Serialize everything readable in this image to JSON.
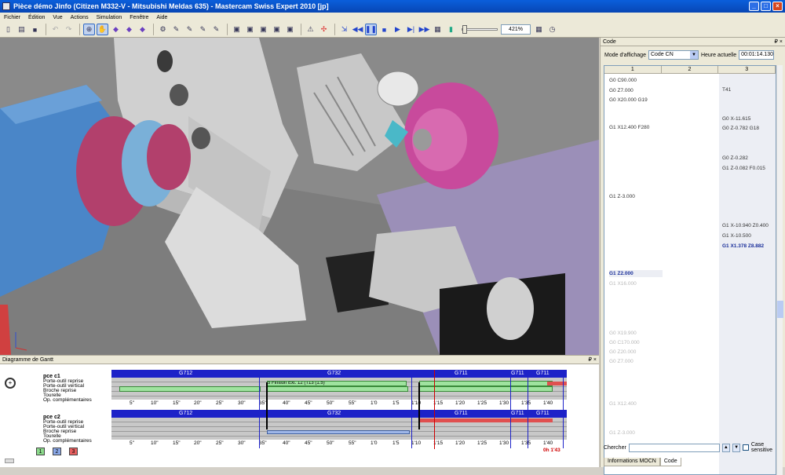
{
  "window": {
    "title": "Pièce démo Jinfo (Citizen M332-V - Mitsubishi Meldas 635) - Mastercam Swiss Expert 2010 [jp]"
  },
  "menu": [
    "Fichier",
    "Édition",
    "Vue",
    "Actions",
    "Simulation",
    "Fenêtre",
    "Aide"
  ],
  "toolbar": {
    "zoom": "421%"
  },
  "code_panel": {
    "title": "Code",
    "mode_label": "Mode d'affichage",
    "mode_value": "Code CN",
    "time_label": "Heure actuelle",
    "time_value": "00:01:14.130",
    "columns": [
      "1",
      "2",
      "3"
    ],
    "lines_col1": [
      {
        "text": "G0 C90.000",
        "state": "done"
      },
      {
        "text": "G0 Z7.000",
        "state": "done"
      },
      {
        "text": "G0 X20.000 G19",
        "state": "done"
      },
      {
        "text": "G1 X12.400 F280",
        "state": "done"
      },
      {
        "text": "G1 Z-3.000",
        "state": "done"
      },
      {
        "text": "G1 Z2.000",
        "state": "cur"
      },
      {
        "text": "G1 X16.000",
        "state": "fut"
      },
      {
        "text": "G0 X19.900",
        "state": "fut"
      },
      {
        "text": "G0 C170.000",
        "state": "fut"
      },
      {
        "text": "G0 Z20.000",
        "state": "fut"
      },
      {
        "text": "G0 Z7.000",
        "state": "fut"
      },
      {
        "text": "G1 X12.400",
        "state": "fut"
      },
      {
        "text": "G1 Z-3.000",
        "state": "fut"
      }
    ],
    "lines_col3": [
      {
        "text": "T41",
        "state": "done"
      },
      {
        "text": "G0 X-11.615",
        "state": "done"
      },
      {
        "text": "G0 Z-0.782 G18",
        "state": "done"
      },
      {
        "text": "G0 Z-0.282",
        "state": "done"
      },
      {
        "text": "G1 Z-0.082 F0.015",
        "state": "done"
      },
      {
        "text": "G1 X-10.940 Z0.400",
        "state": "done"
      },
      {
        "text": "G1 X-10.500",
        "state": "done"
      },
      {
        "text": "G1 X1.378 Z8.882",
        "state": "cur"
      }
    ],
    "search_label": "Chercher",
    "case_label": "Case sensitive",
    "tabs": [
      "Informations MOCN",
      "Code"
    ]
  },
  "gantt": {
    "title": "Diagramme de Gantt",
    "tracks1": {
      "head": "pce c1",
      "rows": [
        "Porte-outil reprise",
        "Porte-outil vertical",
        "Broche reprise",
        "Tourelle",
        "Op. complémentaires"
      ]
    },
    "tracks2": {
      "head": "pce c2",
      "rows": [
        "Porte-outil reprise",
        "Porte-outil vertical",
        "Broche reprise",
        "Tourelle",
        "Op. complémentaires"
      ]
    },
    "bands": [
      {
        "label": "G712"
      },
      {
        "label": "G732"
      },
      {
        "label": "G711"
      },
      {
        "label": "G711"
      },
      {
        "label": "G711"
      }
    ],
    "bar_label": "5 Finition Ext. 12 (T13 (1.5)",
    "ticks": [
      "5\"",
      "10\"",
      "15\"",
      "20\"",
      "25\"",
      "30\"",
      "35\"",
      "40\"",
      "45\"",
      "50\"",
      "55\"",
      "1'0",
      "1'5",
      "1'10",
      "1'15",
      "1'20",
      "1'25",
      "1'30",
      "1'35",
      "1'40"
    ],
    "end_time": "0h 1'43",
    "buttons": [
      "1",
      "2",
      "3"
    ]
  }
}
